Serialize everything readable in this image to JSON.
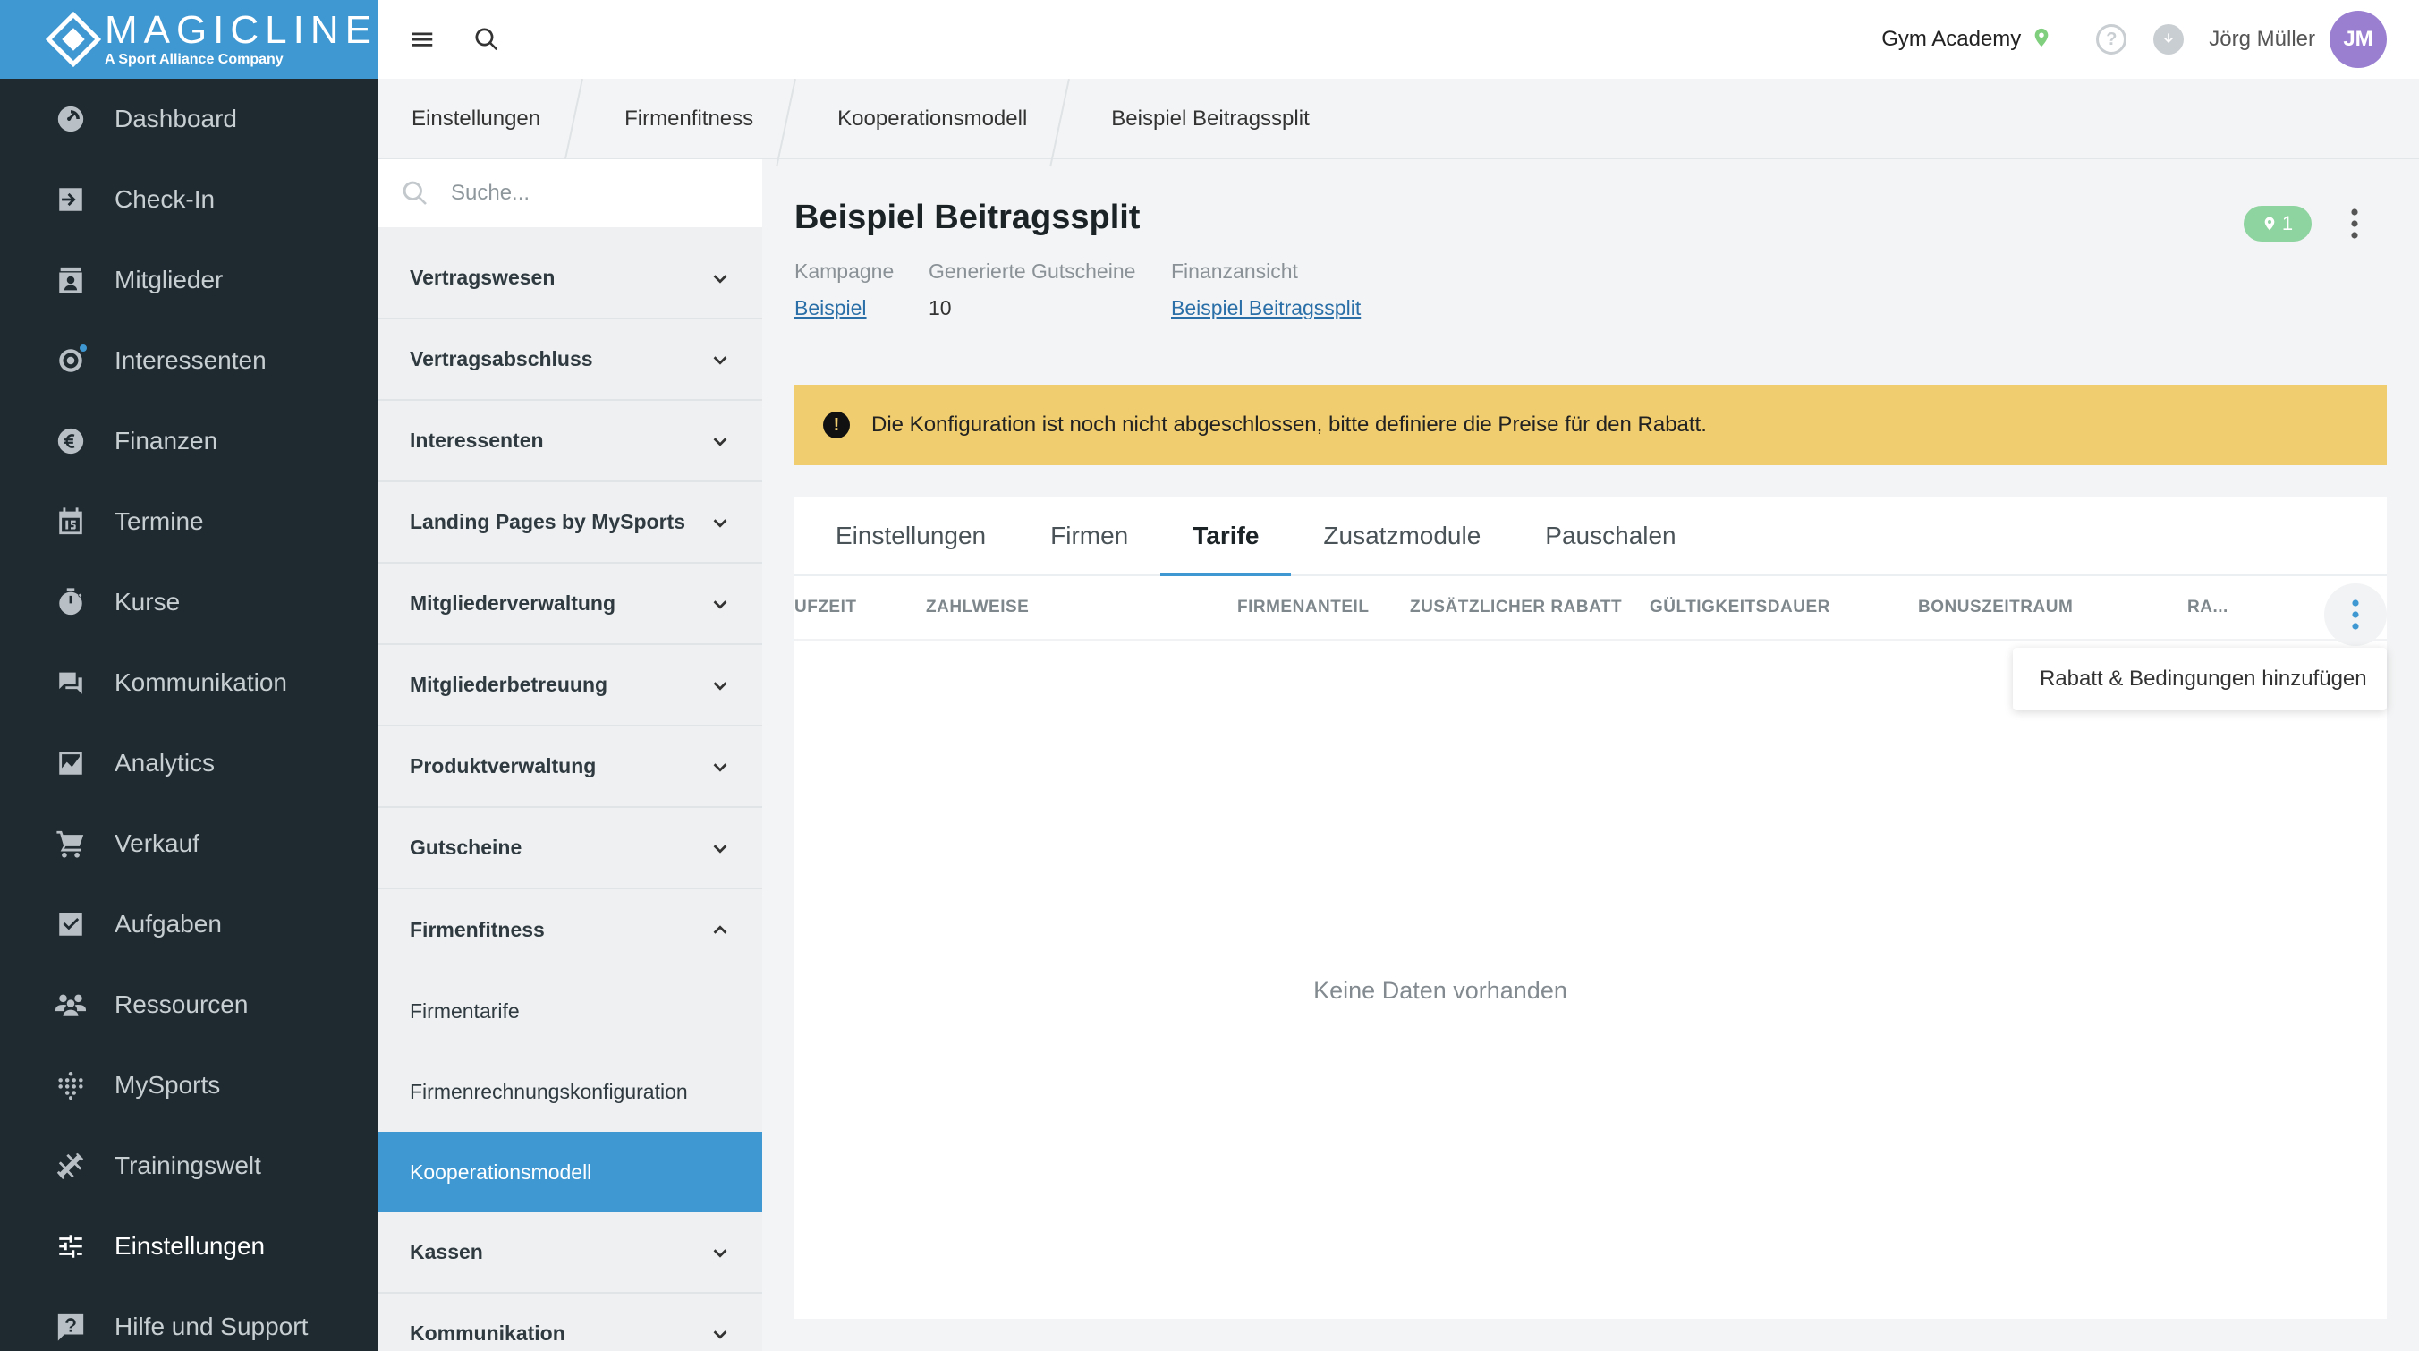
{
  "brand": {
    "name": "MAGICLINE",
    "subtitle": "A Sport Alliance Company"
  },
  "nav": [
    {
      "label": "Dashboard",
      "icon": "dashboard-icon"
    },
    {
      "label": "Check-In",
      "icon": "check-in-icon"
    },
    {
      "label": "Mitglieder",
      "icon": "members-icon"
    },
    {
      "label": "Interessenten",
      "icon": "prospects-icon"
    },
    {
      "label": "Finanzen",
      "icon": "euro-icon"
    },
    {
      "label": "Termine",
      "icon": "calendar-icon"
    },
    {
      "label": "Kurse",
      "icon": "stopwatch-icon"
    },
    {
      "label": "Kommunikation",
      "icon": "chat-icon"
    },
    {
      "label": "Analytics",
      "icon": "chart-icon"
    },
    {
      "label": "Verkauf",
      "icon": "cart-icon"
    },
    {
      "label": "Aufgaben",
      "icon": "checkbox-icon"
    },
    {
      "label": "Ressourcen",
      "icon": "group-icon"
    },
    {
      "label": "MySports",
      "icon": "dots-grid-icon"
    },
    {
      "label": "Trainingswelt",
      "icon": "dumbbell-icon"
    },
    {
      "label": "Einstellungen",
      "icon": "sliders-icon"
    },
    {
      "label": "Hilfe und Support",
      "icon": "help-chat-icon"
    }
  ],
  "topbar": {
    "studio": "Gym Academy",
    "user": "Jörg Müller",
    "initials": "JM"
  },
  "breadcrumb": [
    "Einstellungen",
    "Firmenfitness",
    "Kooperationsmodell",
    "Beispiel Beitragssplit"
  ],
  "submenu": {
    "search_placeholder": "Suche...",
    "groups_top": [
      "Vertragswesen",
      "Vertragsabschluss",
      "Interessenten",
      "Landing Pages by MySports",
      "Mitgliederverwaltung",
      "Mitgliederbetreuung",
      "Produktverwaltung",
      "Gutscheine"
    ],
    "expanded": "Firmenfitness",
    "sub_items": [
      "Firmentarife",
      "Firmenrechnungskonfiguration",
      "Kooperationsmodell"
    ],
    "groups_bottom": [
      "Kassen",
      "Kommunikation"
    ]
  },
  "detail": {
    "title": "Beispiel Beitragssplit",
    "badge_count": "1",
    "meta": {
      "kampagne_label": "Kampagne",
      "kampagne_value": "Beispiel",
      "gutscheine_label": "Generierte Gutscheine",
      "gutscheine_value": "10",
      "finanz_label": "Finanzansicht",
      "finanz_value": "Beispiel Beitragssplit"
    },
    "alert": "Die Konfiguration ist noch nicht abgeschlossen, bitte definiere die Preise für den Rabatt.",
    "tabs": [
      "Einstellungen",
      "Firmen",
      "Tarife",
      "Zusatzmodule",
      "Pauschalen"
    ],
    "active_tab": "Tarife",
    "columns": [
      "UFZEIT",
      "ZAHLWEISE",
      "FIRMENANTEIL",
      "ZUSÄTZLICHER RABATT",
      "GÜLTIGKEITSDAUER",
      "BONUSZEITRAUM",
      "RA..."
    ],
    "menu_item": "Rabatt & Bedingungen hinzufügen",
    "empty": "Keine Daten vorhanden"
  },
  "colors": {
    "brand": "#3f98d2",
    "sidebar": "#1f2a30",
    "alert": "#f0cd6e",
    "badge": "#8ed4a0",
    "avatar": "#9a7fd1"
  }
}
